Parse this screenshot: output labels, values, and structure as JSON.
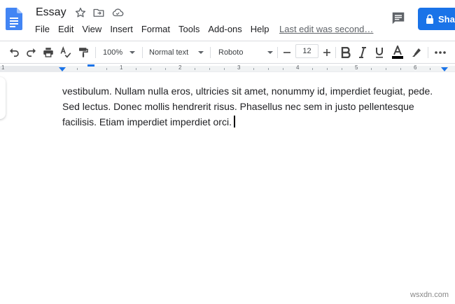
{
  "header": {
    "doc_title": "Essay",
    "last_edit": "Last edit was second…",
    "share_label": "Share",
    "menu": [
      "File",
      "Edit",
      "View",
      "Insert",
      "Format",
      "Tools",
      "Add-ons",
      "Help"
    ],
    "icons": [
      "docs-logo-icon",
      "star-icon",
      "move-to-folder-icon",
      "cloud-saved-icon",
      "comments-icon",
      "lock-icon"
    ]
  },
  "toolbar": {
    "zoom": "100%",
    "style": "Normal text",
    "font": "Roboto",
    "font_size": "12",
    "icons": [
      "undo-icon",
      "redo-icon",
      "print-icon",
      "spellcheck-icon",
      "paint-format-icon",
      "decrease-font-icon",
      "increase-font-icon",
      "bold-icon",
      "italic-icon",
      "underline-icon",
      "text-color-icon",
      "highlight-icon",
      "more-icon"
    ]
  },
  "ruler": {
    "numbers": [
      "1",
      "1",
      "2",
      "3",
      "4",
      "5",
      "6"
    ]
  },
  "document": {
    "lines": [
      "vestibulum. Nullam nulla eros, ultricies sit amet, nonummy id, imperdiet feugiat, pede.",
      "Sed lectus. Donec mollis hendrerit risus. Phasellus nec sem in justo pellentesque",
      "facilisis. Etiam imperdiet imperdiet orci."
    ]
  },
  "watermark": "wsxdn.com",
  "colors": {
    "accent": "#1a73e8",
    "docs_blue": "#4285f4",
    "text": "#202124"
  }
}
